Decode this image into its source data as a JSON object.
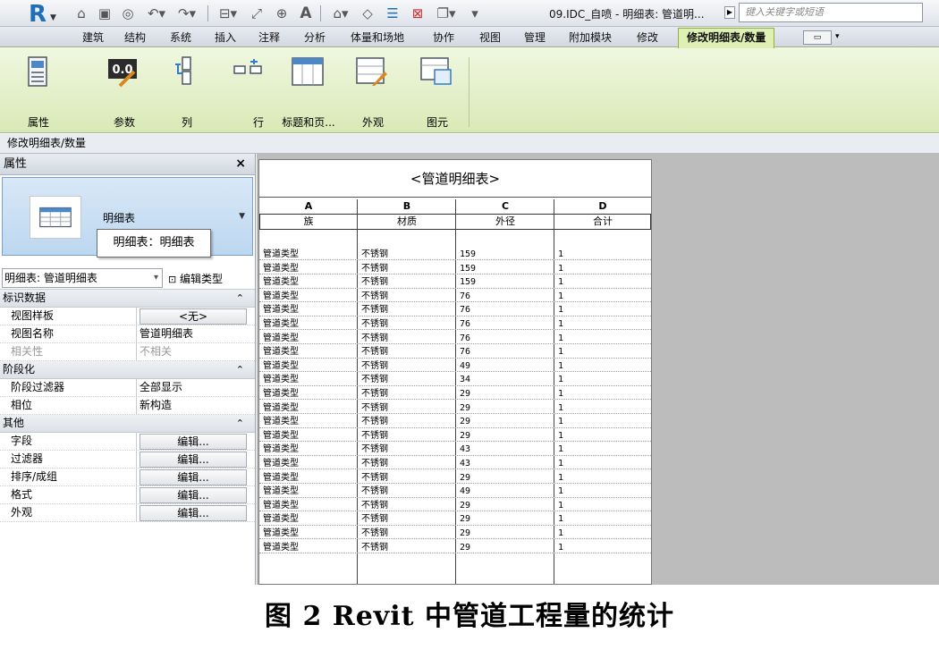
{
  "quick_access": {
    "app_menu_icon": "revit-r-icon",
    "icons": [
      "open-icon",
      "save-icon",
      "sync-icon",
      "undo-icon",
      "redo-icon",
      "measure-icon",
      "dimension-icon",
      "tag-icon",
      "text-icon",
      "3d-view-icon",
      "section-icon",
      "thin-lines-icon",
      "close-hidden-icon",
      "switch-window-icon",
      "customize-icon"
    ],
    "document_title": "09.IDC_自喷 - 明细表: 管道明...",
    "search_placeholder": "键入关键字或短语"
  },
  "ribbon_tabs": [
    {
      "label": "建筑"
    },
    {
      "label": "结构"
    },
    {
      "label": "系统"
    },
    {
      "label": "插入"
    },
    {
      "label": "注释"
    },
    {
      "label": "分析"
    },
    {
      "label": "体量和场地"
    },
    {
      "label": "协作"
    },
    {
      "label": "视图"
    },
    {
      "label": "管理"
    },
    {
      "label": "附加模块"
    },
    {
      "label": "修改"
    },
    {
      "label": "修改明细表/数量",
      "active": true
    }
  ],
  "ribbon_buttons": [
    {
      "label": "属性",
      "icon": "properties-icon"
    },
    {
      "label": "参数",
      "icon": "parameter-icon",
      "icon_text": "0.0"
    },
    {
      "label": "列",
      "icon": "column-icon"
    },
    {
      "label": "行",
      "icon": "row-icon"
    },
    {
      "label": "标题和页...",
      "icon": "titles-headers-icon"
    },
    {
      "label": "外观",
      "icon": "appearance-icon"
    },
    {
      "label": "图元",
      "icon": "element-icon"
    }
  ],
  "context_bar": {
    "label": "修改明细表/数量"
  },
  "properties": {
    "title": "属性",
    "close_icon": "×",
    "type_name": "明细表",
    "tooltip": "明细表：明细表",
    "instance_selector": "明细表: 管道明细表",
    "edit_type": "编辑类型",
    "groups": [
      {
        "label": "标识数据",
        "rows": [
          {
            "key": "视图样板",
            "value": "<无>",
            "button": true
          },
          {
            "key": "视图名称",
            "value": "管道明细表"
          },
          {
            "key": "相关性",
            "value": "不相关",
            "disabled": true
          }
        ]
      },
      {
        "label": "阶段化",
        "rows": [
          {
            "key": "阶段过滤器",
            "value": "全部显示"
          },
          {
            "key": "相位",
            "value": "新构造"
          }
        ]
      },
      {
        "label": "其他",
        "rows": [
          {
            "key": "字段",
            "value": "编辑...",
            "button": true
          },
          {
            "key": "过滤器",
            "value": "编辑...",
            "button": true
          },
          {
            "key": "排序/成组",
            "value": "编辑...",
            "button": true
          },
          {
            "key": "格式",
            "value": "编辑...",
            "button": true
          },
          {
            "key": "外观",
            "value": "编辑...",
            "button": true
          }
        ]
      }
    ]
  },
  "schedule": {
    "title": "<管道明细表>",
    "column_letters": [
      "A",
      "B",
      "C",
      "D"
    ],
    "column_headers": [
      "族",
      "材质",
      "外径",
      "合计"
    ],
    "rows": [
      [
        "管道类型",
        "不锈钢",
        "159",
        "1"
      ],
      [
        "管道类型",
        "不锈钢",
        "159",
        "1"
      ],
      [
        "管道类型",
        "不锈钢",
        "159",
        "1"
      ],
      [
        "管道类型",
        "不锈钢",
        "76",
        "1"
      ],
      [
        "管道类型",
        "不锈钢",
        "76",
        "1"
      ],
      [
        "管道类型",
        "不锈钢",
        "76",
        "1"
      ],
      [
        "管道类型",
        "不锈钢",
        "76",
        "1"
      ],
      [
        "管道类型",
        "不锈钢",
        "76",
        "1"
      ],
      [
        "管道类型",
        "不锈钢",
        "49",
        "1"
      ],
      [
        "管道类型",
        "不锈钢",
        "34",
        "1"
      ],
      [
        "管道类型",
        "不锈钢",
        "29",
        "1"
      ],
      [
        "管道类型",
        "不锈钢",
        "29",
        "1"
      ],
      [
        "管道类型",
        "不锈钢",
        "29",
        "1"
      ],
      [
        "管道类型",
        "不锈钢",
        "29",
        "1"
      ],
      [
        "管道类型",
        "不锈钢",
        "43",
        "1"
      ],
      [
        "管道类型",
        "不锈钢",
        "43",
        "1"
      ],
      [
        "管道类型",
        "不锈钢",
        "29",
        "1"
      ],
      [
        "管道类型",
        "不锈钢",
        "49",
        "1"
      ],
      [
        "管道类型",
        "不锈钢",
        "29",
        "1"
      ],
      [
        "管道类型",
        "不锈钢",
        "29",
        "1"
      ],
      [
        "管道类型",
        "不锈钢",
        "29",
        "1"
      ],
      [
        "管道类型",
        "不锈钢",
        "29",
        "1"
      ]
    ]
  },
  "caption": "图 2  Revit 中管道工程量的统计",
  "colors": {
    "ribbon_active": "#dff0b4",
    "type_selector": "#bcd7f0",
    "canvas": "#bcbcbc"
  }
}
